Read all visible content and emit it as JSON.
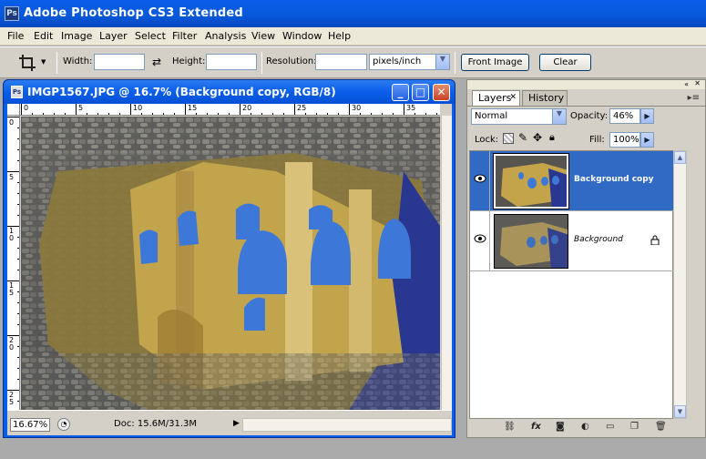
{
  "app": {
    "title": "Adobe Photoshop CS3 Extended",
    "logo": "Ps"
  },
  "menubar": {
    "items": [
      "File",
      "Edit",
      "Image",
      "Layer",
      "Select",
      "Filter",
      "Analysis",
      "View",
      "Window",
      "Help"
    ]
  },
  "options": {
    "tool_icon": "crop-icon",
    "width_label": "Width:",
    "width_value": "",
    "swap_icon": "swap-icon",
    "height_label": "Height:",
    "height_value": "",
    "resolution_label": "Resolution:",
    "resolution_value": "",
    "units": "pixels/inch",
    "front_image_label": "Front Image",
    "clear_label": "Clear"
  },
  "document": {
    "logo": "Ps",
    "title": "IMGP1567.JPG @ 16.7% (Background copy, RGB/8)",
    "ruler_h": [
      "0",
      "5",
      "10",
      "15",
      "20",
      "25",
      "30",
      "35"
    ],
    "ruler_v": [
      "0",
      "5",
      "1 0",
      "1 5",
      "2 0",
      "2 5"
    ],
    "zoom": "16.67%",
    "doc_info": "Doc: 15.6M/31.3M"
  },
  "panel": {
    "tabs": [
      "Layers",
      "History"
    ],
    "blend_mode": "Normal",
    "opacity_label": "Opacity:",
    "opacity_value": "46%",
    "lock_label": "Lock:",
    "fill_label": "Fill:",
    "fill_value": "100%",
    "layers": [
      {
        "name": "Background copy",
        "selected": true
      },
      {
        "name": "Background",
        "selected": false
      }
    ],
    "footer_icons": [
      "link-icon",
      "fx-icon",
      "mask-icon",
      "adjustment-icon",
      "group-folder-icon",
      "new-layer-icon",
      "trash-icon"
    ]
  },
  "colors": {
    "xp_blue": "#0a5ee8",
    "selection": "#316ac5",
    "close_red": "#c84226"
  }
}
